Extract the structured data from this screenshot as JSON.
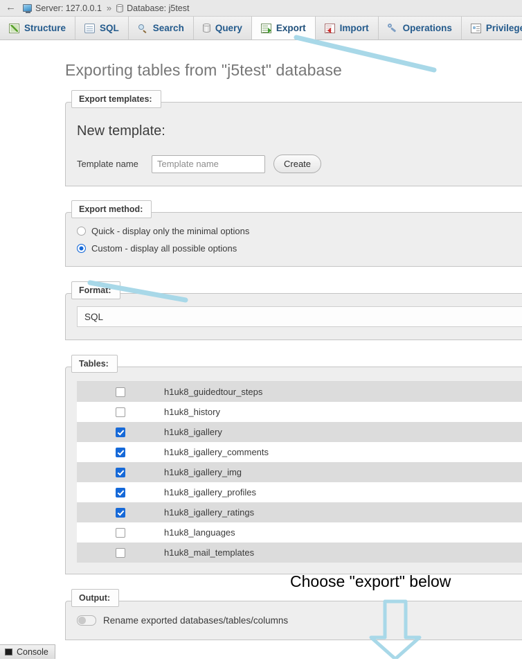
{
  "breadcrumb": {
    "back_label": "←",
    "server": "Server: 127.0.0.1",
    "separator": "»",
    "database": "Database: j5test"
  },
  "tabs": [
    {
      "label": "Structure",
      "icon": "structure-icon",
      "active": false
    },
    {
      "label": "SQL",
      "icon": "sql-icon",
      "active": false
    },
    {
      "label": "Search",
      "icon": "search-icon",
      "active": false
    },
    {
      "label": "Query",
      "icon": "query-icon",
      "active": false
    },
    {
      "label": "Export",
      "icon": "export-icon",
      "active": true
    },
    {
      "label": "Import",
      "icon": "import-icon",
      "active": false
    },
    {
      "label": "Operations",
      "icon": "operations-icon",
      "active": false
    },
    {
      "label": "Privileges",
      "icon": "privileges-icon",
      "active": false
    }
  ],
  "page": {
    "title": "Exporting tables from \"j5test\" database"
  },
  "export_templates": {
    "legend": "Export templates:",
    "new_template_title": "New template:",
    "template_name_label": "Template name",
    "template_name_value": "",
    "template_name_placeholder": "Template name",
    "create_button": "Create"
  },
  "export_method": {
    "legend": "Export method:",
    "options": [
      {
        "label": "Quick - display only the minimal options",
        "checked": false
      },
      {
        "label": "Custom - display all possible options",
        "checked": true
      }
    ]
  },
  "format": {
    "legend": "Format:",
    "selected": "SQL"
  },
  "tables": {
    "legend": "Tables:",
    "rows": [
      {
        "name": "h1uk8_guidedtour_steps",
        "checked": false
      },
      {
        "name": "h1uk8_history",
        "checked": false
      },
      {
        "name": "h1uk8_igallery",
        "checked": true
      },
      {
        "name": "h1uk8_igallery_comments",
        "checked": true
      },
      {
        "name": "h1uk8_igallery_img",
        "checked": true
      },
      {
        "name": "h1uk8_igallery_profiles",
        "checked": true
      },
      {
        "name": "h1uk8_igallery_ratings",
        "checked": true
      },
      {
        "name": "h1uk8_languages",
        "checked": false
      },
      {
        "name": "h1uk8_mail_templates",
        "checked": false
      }
    ]
  },
  "output": {
    "legend": "Output:",
    "rename_label": "Rename exported databases/tables/columns",
    "rename_checked": false
  },
  "console": {
    "label": "Console"
  },
  "annotations": {
    "arrow_color": "#a8d8e8",
    "note_text": "Choose \"export\" below"
  }
}
